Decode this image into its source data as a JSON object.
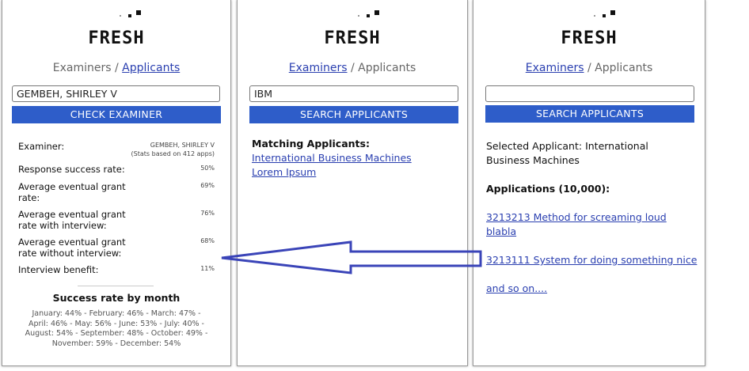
{
  "app": {
    "logo": "FRESH"
  },
  "breadcrumb": {
    "examiners": "Examiners",
    "separator": "/",
    "applicants": "Applicants"
  },
  "panel1": {
    "search_value": "GEMBEH, SHIRLEY V",
    "button": "CHECK EXAMINER",
    "examiner_label": "Examiner:",
    "examiner_name": "GEMBEH, SHIRLEY V",
    "examiner_note": "(Stats based on 412 apps)",
    "stats": [
      {
        "label_lines": [
          "Response success rate:"
        ],
        "value": "50%"
      },
      {
        "label_lines": [
          "Average eventual grant",
          "rate:"
        ],
        "value": "69%"
      },
      {
        "label_lines": [
          "Average eventual grant",
          "rate with interview:"
        ],
        "value": "76%"
      },
      {
        "label_lines": [
          "Average eventual grant",
          "rate without interview:"
        ],
        "value": "68%"
      },
      {
        "label_lines": [
          "Interview benefit:"
        ],
        "value": "11%"
      }
    ],
    "monthly_title": "Success rate by month",
    "monthly_lines": [
      "January: 44% - February: 46% - March: 47% -",
      "April: 46% - May: 56% - June: 53% - July: 40% -",
      "August: 54% - September: 48% - October: 49% -",
      "November: 59% - December: 54%"
    ]
  },
  "panel2": {
    "search_value": "IBM",
    "button": "SEARCH APPLICANTS",
    "matching_title": "Matching Applicants:",
    "matches": [
      "International Business Machines",
      "Lorem Ipsum"
    ]
  },
  "panel3": {
    "search_value": "",
    "button": "SEARCH APPLICANTS",
    "selected_lines": [
      "Selected Applicant: International",
      "Business Machines"
    ],
    "applications_title": "Applications (10,000):",
    "applications": [
      [
        "3213213 Method for screaming loud",
        "blabla"
      ],
      [
        "3213111 System for doing something nice"
      ],
      [
        "and so on...."
      ]
    ]
  },
  "colors": {
    "button": "#2e5dc9",
    "link": "#2a3fb0",
    "arrow": "#3a44b8"
  },
  "icons": {
    "arrow": "left-arrow-icon"
  }
}
